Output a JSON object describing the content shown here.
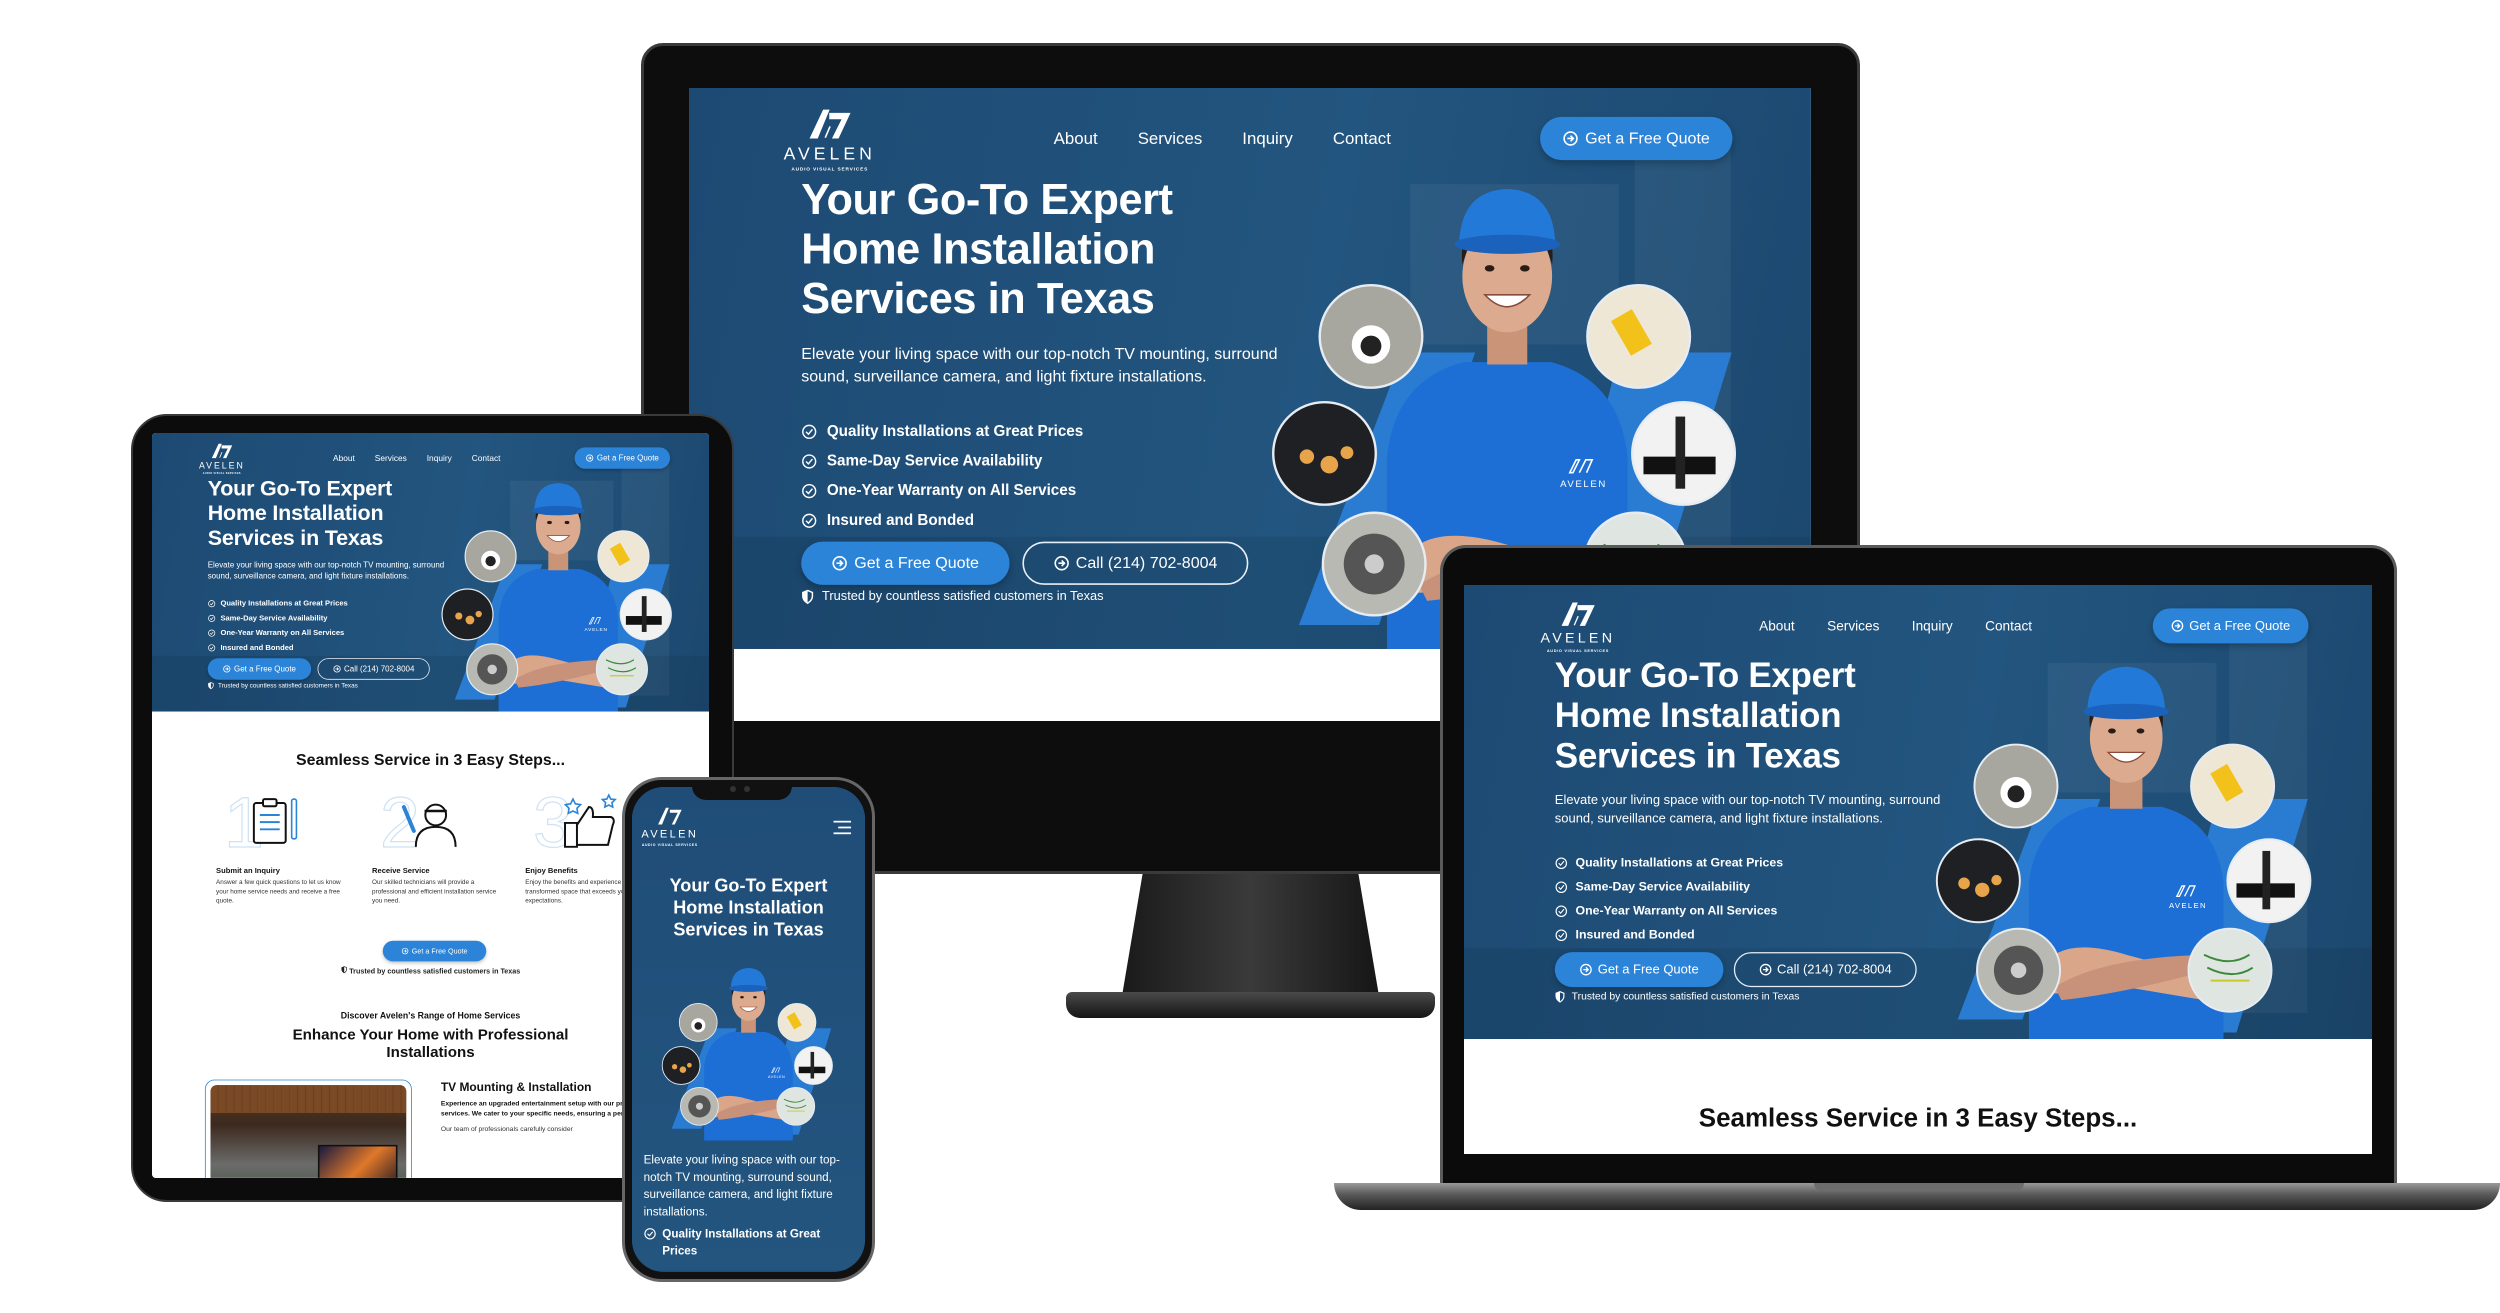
{
  "brand": {
    "name": "AVELEN",
    "tagline": "AUDIO VISUAL SERVICES"
  },
  "nav": {
    "links": [
      "About",
      "Services",
      "Inquiry",
      "Contact"
    ],
    "cta": "Get a Free Quote"
  },
  "hero": {
    "title": "Your Go-To Expert\nHome Installation\nServices in Texas",
    "description": "Elevate your living space with our top-notch TV mounting, surround sound, surveillance camera, and light fixture installations.",
    "features": [
      "Quality Installations at Great Prices",
      "Same-Day Service Availability",
      "One-Year Warranty on All Services",
      "Insured and Bonded"
    ],
    "primary_button": "Get a Free Quote",
    "call_button": "Call (214) 702-8004",
    "trust": "Trusted by countless satisfied customers in Texas"
  },
  "steps": {
    "title": "Seamless Service in 3 Easy Steps...",
    "items": [
      {
        "number": "1",
        "icon": "clipboard-icon",
        "title": "Submit an Inquiry",
        "text": "Answer a few quick questions to let us know your home service needs and receive a free quote."
      },
      {
        "number": "2",
        "icon": "technician-icon",
        "title": "Receive Service",
        "text": "Our skilled technicians will provide a professional and efficient installation service you need."
      },
      {
        "number": "3",
        "icon": "thumbs-up-icon",
        "title": "Enjoy Benefits",
        "text": "Enjoy the benefits and experience a transformed space that exceeds your expectations."
      }
    ],
    "button": "Get a Free Quote",
    "trust": "Trusted by countless satisfied customers in Texas"
  },
  "services": {
    "eyebrow": "Discover Avelen's Range of Home Services",
    "title": "Enhance Your Home with Professional Installations",
    "items": [
      {
        "title": "TV Mounting & Installation",
        "lead": "Experience an upgraded entertainment setup with our precision TV mounting services. We cater to your specific needs, ensuring a perfect fit for your space.",
        "text": "Our team of professionals carefully consider"
      }
    ]
  },
  "colors": {
    "hero_bg": "#1f4d78",
    "accent": "#2b84d7",
    "shirt": "#1d6fd6"
  }
}
